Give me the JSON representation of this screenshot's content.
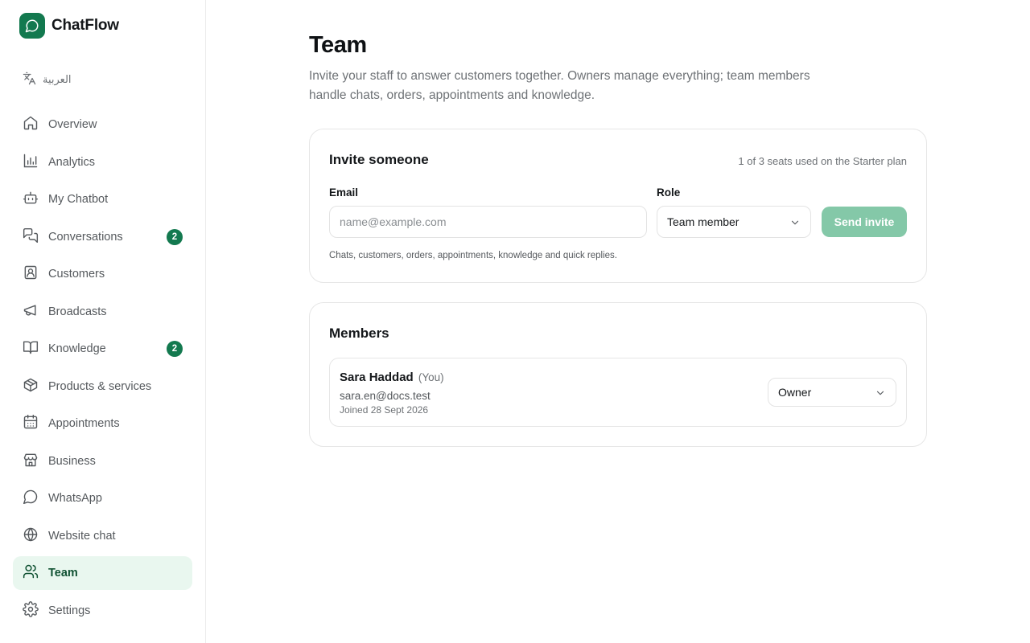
{
  "brand": {
    "name": "ChatFlow",
    "logo_icon": "chat-bubble-icon",
    "color": "#13794f"
  },
  "language_switch": {
    "label": "العربية",
    "icon": "translate-icon"
  },
  "sidebar": {
    "items": [
      {
        "label": "Overview",
        "icon": "home-icon",
        "active": false
      },
      {
        "label": "Analytics",
        "icon": "bar-chart-icon",
        "active": false
      },
      {
        "label": "My Chatbot",
        "icon": "bot-icon",
        "active": false
      },
      {
        "label": "Conversations",
        "icon": "messages-icon",
        "active": false,
        "badge": "2"
      },
      {
        "label": "Customers",
        "icon": "contact-card-icon",
        "active": false
      },
      {
        "label": "Broadcasts",
        "icon": "megaphone-icon",
        "active": false
      },
      {
        "label": "Knowledge",
        "icon": "book-icon",
        "active": false,
        "badge": "2"
      },
      {
        "label": "Products & services",
        "icon": "package-icon",
        "active": false
      },
      {
        "label": "Appointments",
        "icon": "calendar-icon",
        "active": false
      },
      {
        "label": "Business",
        "icon": "store-icon",
        "active": false
      },
      {
        "label": "WhatsApp",
        "icon": "chat-bubble-icon",
        "active": false
      },
      {
        "label": "Website chat",
        "icon": "globe-icon",
        "active": false
      },
      {
        "label": "Team",
        "icon": "users-icon",
        "active": true
      },
      {
        "label": "Settings",
        "icon": "gear-icon",
        "active": false
      }
    ]
  },
  "page": {
    "title": "Team",
    "description": "Invite your staff to answer customers together. Owners manage everything; team members handle chats, orders, appointments and knowledge."
  },
  "invite": {
    "title": "Invite someone",
    "seats": "1 of 3 seats used on the Starter plan",
    "email_label": "Email",
    "email_placeholder": "name@example.com",
    "email_value": "",
    "role_label": "Role",
    "role_value": "Team member",
    "send_label": "Send invite",
    "hint": "Chats, customers, orders, appointments, knowledge and quick replies."
  },
  "members": {
    "title": "Members",
    "list": [
      {
        "name": "Sara Haddad",
        "you": "(You)",
        "email": "sara.en@docs.test",
        "joined": "Joined 28 Sept 2026",
        "role": "Owner"
      }
    ]
  },
  "colors": {
    "accent": "#13794f",
    "active_bg": "#e9f7ef",
    "send_disabled": "#84c8a8"
  }
}
